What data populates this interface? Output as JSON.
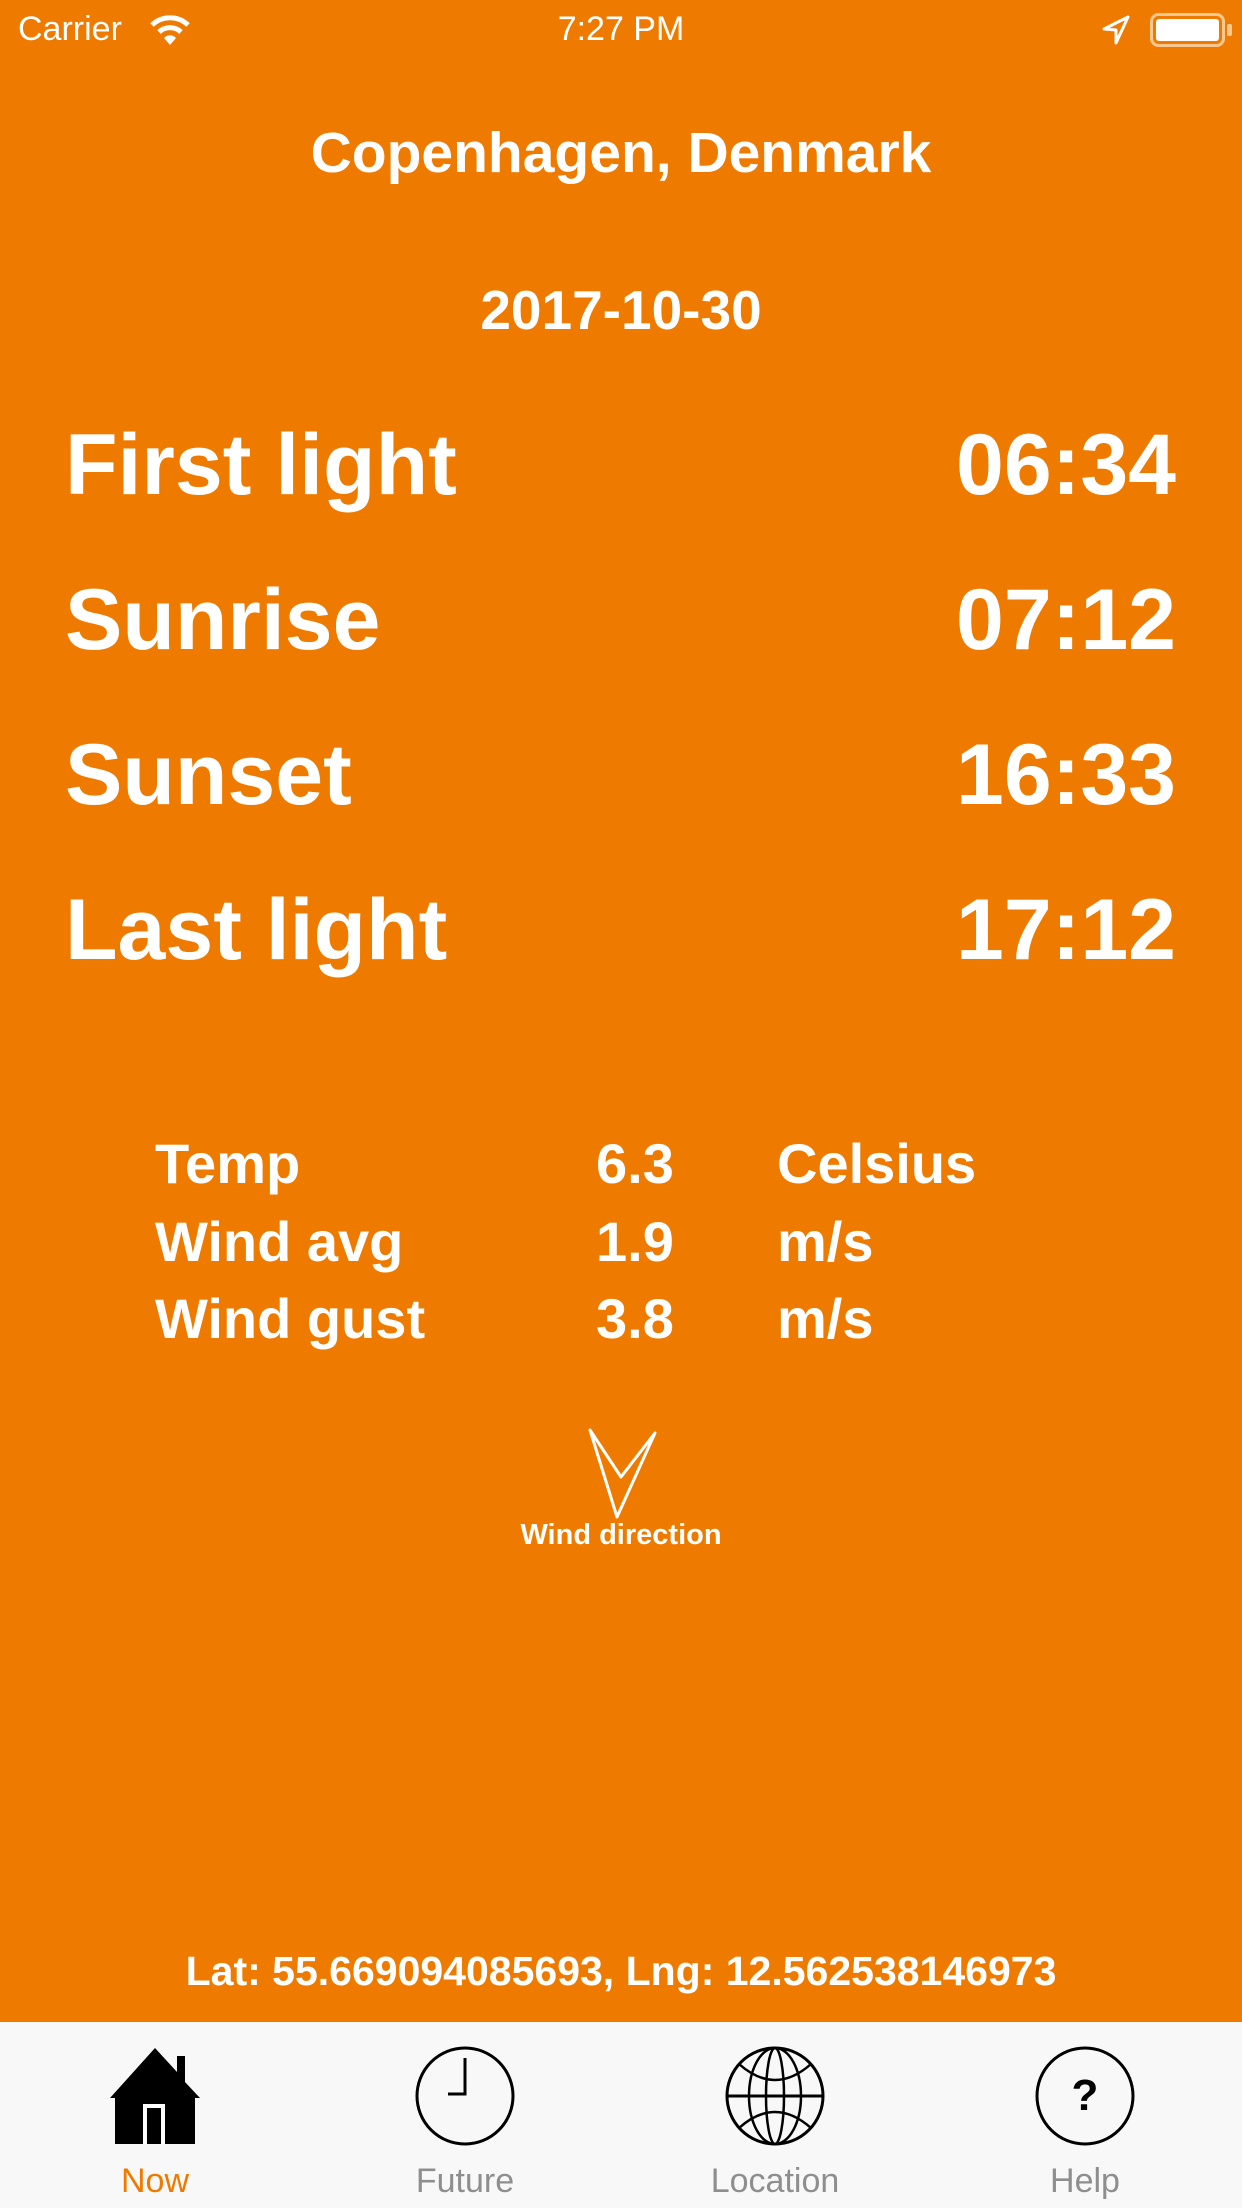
{
  "status_bar": {
    "carrier": "Carrier",
    "time": "7:27 PM"
  },
  "header": {
    "location": "Copenhagen, Denmark",
    "date": "2017-10-30"
  },
  "sun_times": [
    {
      "label": "First light",
      "time": "06:34"
    },
    {
      "label": "Sunrise",
      "time": "07:12"
    },
    {
      "label": "Sunset",
      "time": "16:33"
    },
    {
      "label": "Last light",
      "time": "17:12"
    }
  ],
  "weather": [
    {
      "label": "Temp",
      "value": "6.3",
      "unit": "Celsius"
    },
    {
      "label": "Wind avg",
      "value": "1.9",
      "unit": "m/s"
    },
    {
      "label": "Wind gust",
      "value": "3.8",
      "unit": "m/s"
    }
  ],
  "wind_direction": {
    "label": "Wind direction",
    "icon": "arrow-down-icon"
  },
  "coordinates": "Lat: 55.669094085693, Lng: 12.562538146973",
  "tabs": [
    {
      "label": "Now",
      "icon": "house-icon",
      "active": true
    },
    {
      "label": "Future",
      "icon": "clock-icon"
    },
    {
      "label": "Location",
      "icon": "globe-icon"
    },
    {
      "label": "Help",
      "icon": "help-icon"
    }
  ],
  "colors": {
    "background": "#ee7b00",
    "active_tab": "#ee7b00",
    "inactive_tab": "#8e8e8e",
    "tabbar": "#f8f8f8"
  }
}
